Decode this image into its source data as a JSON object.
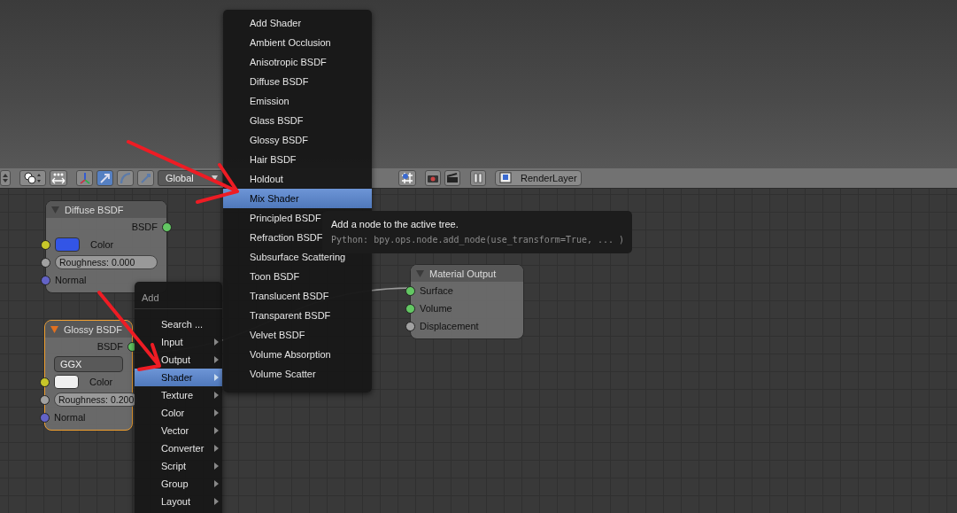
{
  "header": {
    "manipulators": [
      {
        "kind": "axes",
        "selected": false
      },
      {
        "kind": "translate",
        "selected": true
      },
      {
        "kind": "rotate",
        "selected": false
      },
      {
        "kind": "scale",
        "selected": false
      }
    ],
    "orientation": "Global",
    "render_layer": "RenderLayer"
  },
  "nodes": [
    {
      "title": "Diffuse BSDF",
      "selected": false,
      "rows": [
        {
          "kind": "output",
          "label": "BSDF",
          "socket": {
            "color": "#63c763"
          }
        },
        {
          "kind": "color",
          "label": "Color",
          "socket": {
            "color": "#c7c729"
          },
          "swatch": {
            "color": "#3355e6"
          }
        },
        {
          "kind": "value",
          "label": "Roughness: 0.000",
          "socket": {
            "color": "#a1a1a1"
          }
        },
        {
          "kind": "input",
          "label": "Normal",
          "socket": {
            "color": "#6363c7"
          }
        }
      ]
    },
    {
      "title": "Glossy BSDF",
      "selected": true,
      "rows": [
        {
          "kind": "output",
          "label": "BSDF",
          "socket": {
            "color": "#63c763"
          }
        },
        {
          "kind": "dropdown",
          "label": "GGX"
        },
        {
          "kind": "color",
          "label": "Color",
          "socket": {
            "color": "#c7c729"
          },
          "swatch": {
            "color": "#f0f0f0"
          }
        },
        {
          "kind": "value",
          "label": "Roughness: 0.200",
          "socket": {
            "color": "#a1a1a1"
          }
        },
        {
          "kind": "input",
          "label": "Normal",
          "socket": {
            "color": "#6363c7"
          }
        }
      ]
    },
    {
      "title": "Material Output",
      "selected": false,
      "rows": [
        {
          "kind": "input",
          "label": "Surface",
          "socket": {
            "color": "#63c763"
          }
        },
        {
          "kind": "input",
          "label": "Volume",
          "socket": {
            "color": "#63c763"
          }
        },
        {
          "kind": "input",
          "label": "Displacement",
          "socket": {
            "color": "#a1a1a1"
          }
        }
      ]
    }
  ],
  "add_menu": {
    "title": "Add",
    "items": [
      {
        "label": "Search ...",
        "submenu": false,
        "selected": false
      },
      {
        "label": "Input",
        "submenu": true,
        "selected": false
      },
      {
        "label": "Output",
        "submenu": true,
        "selected": false
      },
      {
        "label": "Shader",
        "submenu": true,
        "selected": true
      },
      {
        "label": "Texture",
        "submenu": true,
        "selected": false
      },
      {
        "label": "Color",
        "submenu": true,
        "selected": false
      },
      {
        "label": "Vector",
        "submenu": true,
        "selected": false
      },
      {
        "label": "Converter",
        "submenu": true,
        "selected": false
      },
      {
        "label": "Script",
        "submenu": true,
        "selected": false
      },
      {
        "label": "Group",
        "submenu": true,
        "selected": false
      },
      {
        "label": "Layout",
        "submenu": true,
        "selected": false
      }
    ]
  },
  "shader_menu": {
    "items": [
      {
        "label": "Add Shader",
        "selected": false
      },
      {
        "label": "Ambient Occlusion",
        "selected": false
      },
      {
        "label": "Anisotropic BSDF",
        "selected": false
      },
      {
        "label": "Diffuse BSDF",
        "selected": false
      },
      {
        "label": "Emission",
        "selected": false
      },
      {
        "label": "Glass BSDF",
        "selected": false
      },
      {
        "label": "Glossy BSDF",
        "selected": false
      },
      {
        "label": "Hair BSDF",
        "selected": false
      },
      {
        "label": "Holdout",
        "selected": false
      },
      {
        "label": "Mix Shader",
        "selected": true
      },
      {
        "label": "Principled BSDF",
        "selected": false
      },
      {
        "label": "Refraction BSDF",
        "selected": false
      },
      {
        "label": "Subsurface Scattering",
        "selected": false
      },
      {
        "label": "Toon BSDF",
        "selected": false
      },
      {
        "label": "Translucent BSDF",
        "selected": false
      },
      {
        "label": "Transparent BSDF",
        "selected": false
      },
      {
        "label": "Velvet BSDF",
        "selected": false
      },
      {
        "label": "Volume Absorption",
        "selected": false
      },
      {
        "label": "Volume Scatter",
        "selected": false
      }
    ]
  },
  "tooltip": {
    "text": "Add a node to the active tree.",
    "python": "Python: bpy.ops.node.add_node(use_transform=True, ... )"
  }
}
